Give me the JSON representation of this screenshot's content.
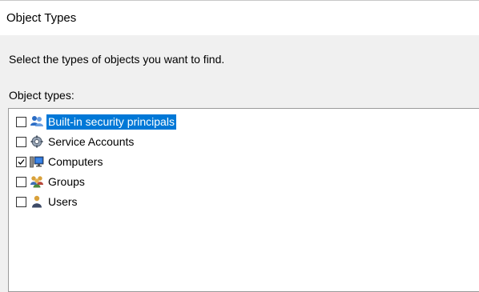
{
  "window": {
    "title": "Object Types"
  },
  "instruction": "Select the types of objects you want to find.",
  "list": {
    "label": "Object types:",
    "items": [
      {
        "label": "Built-in security principals",
        "checked": false,
        "selected": true,
        "icon": "security-principals-icon"
      },
      {
        "label": "Service Accounts",
        "checked": false,
        "selected": false,
        "icon": "service-accounts-icon"
      },
      {
        "label": "Computers",
        "checked": true,
        "selected": false,
        "icon": "computer-icon"
      },
      {
        "label": "Groups",
        "checked": false,
        "selected": false,
        "icon": "groups-icon"
      },
      {
        "label": "Users",
        "checked": false,
        "selected": false,
        "icon": "user-icon"
      }
    ]
  },
  "colors": {
    "selection": "#0078d7",
    "dialog_bg": "#f0f0f0",
    "title_bg": "#ffffff"
  }
}
